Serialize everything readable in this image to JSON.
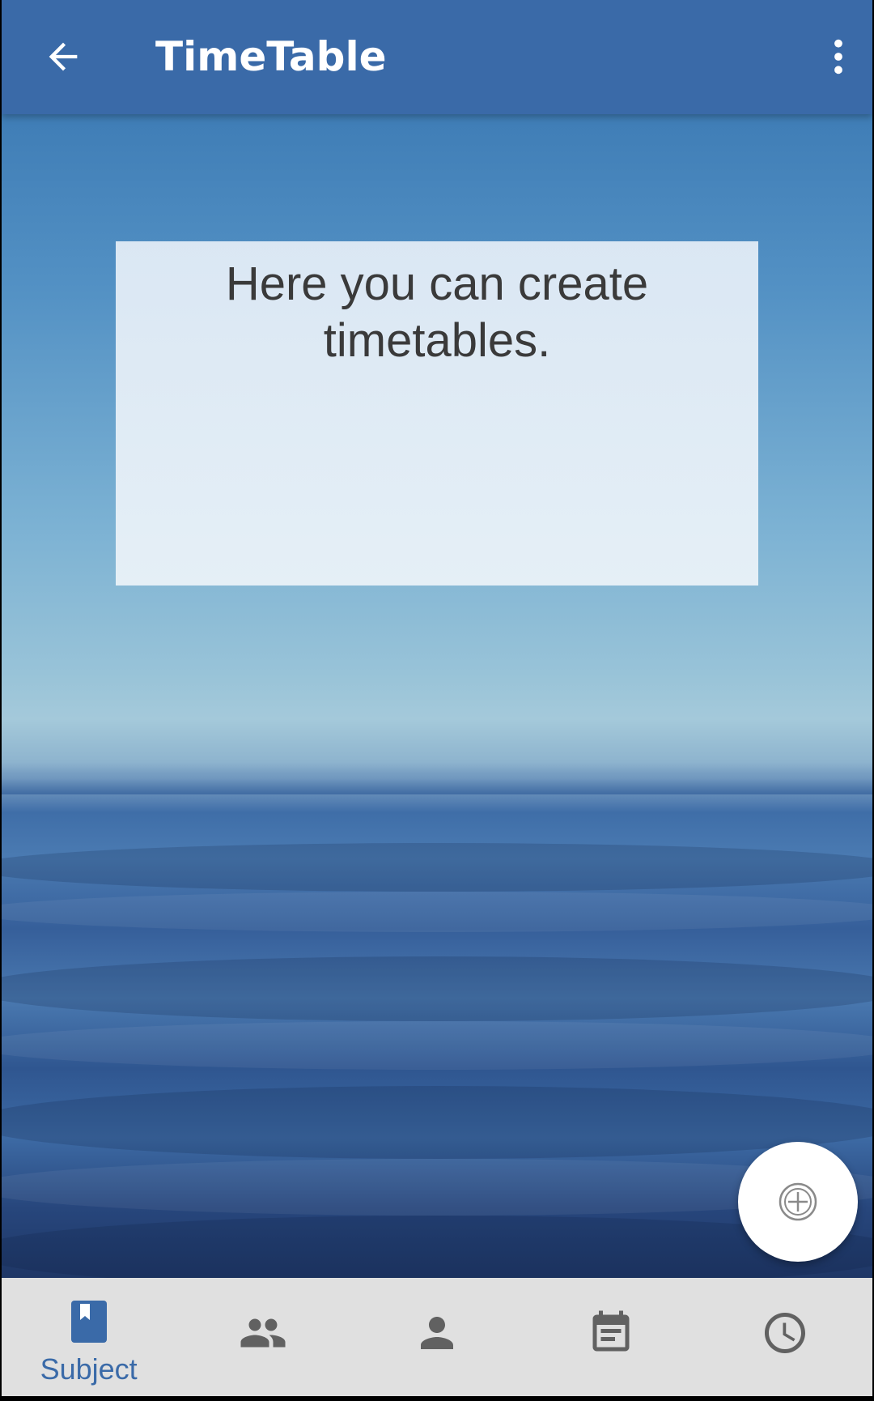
{
  "app_bar": {
    "title": "TimeTable",
    "back_icon": "arrow-back-icon",
    "overflow_icon": "more-vert-icon"
  },
  "info_card": {
    "text_line1": "Here you can create",
    "text_line2": "timetables."
  },
  "fab": {
    "icon": "add-circle-icon"
  },
  "bottom_nav": {
    "items": [
      {
        "icon": "book-icon",
        "label": "Subject",
        "active": true
      },
      {
        "icon": "group-icon",
        "label": "",
        "active": false
      },
      {
        "icon": "person-icon",
        "label": "",
        "active": false
      },
      {
        "icon": "calendar-icon",
        "label": "",
        "active": false
      },
      {
        "icon": "clock-icon",
        "label": "",
        "active": false
      }
    ]
  },
  "colors": {
    "primary": "#3a6aa8",
    "nav_background": "#e0e0e0",
    "inactive_icon": "#616161",
    "card_text": "#3a3a3a"
  }
}
